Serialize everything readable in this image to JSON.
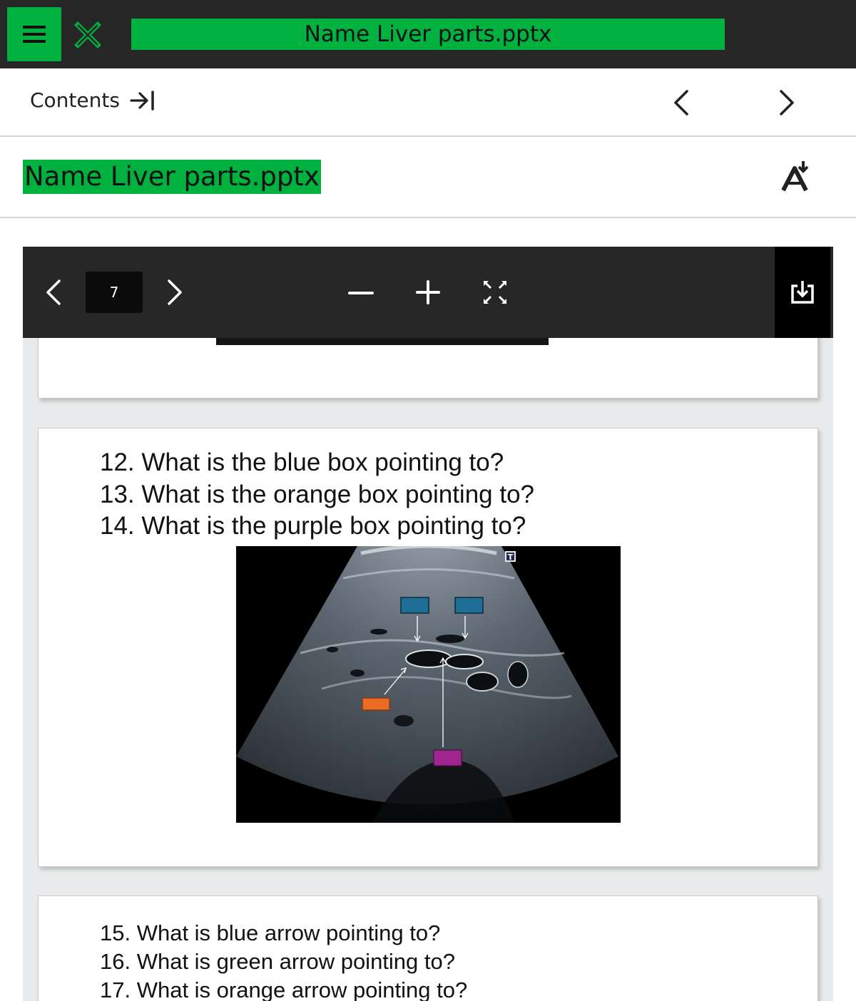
{
  "app": {
    "title": "Name Liver parts.pptx",
    "menu_icon": "hamburger-menu-icon",
    "close_icon": "close-x-icon"
  },
  "contents_bar": {
    "label": "Contents",
    "collapse_icon": "arrow-to-end-icon",
    "prev_icon": "chevron-left-icon",
    "next_icon": "chevron-right-icon"
  },
  "document": {
    "title": "Name Liver parts.pptx",
    "accessibility_icon": "font-accessibility-icon"
  },
  "viewer": {
    "page_number": "7",
    "toolbar_icons": [
      "chevron-left-icon",
      "chevron-right-icon",
      "minus-icon",
      "plus-icon",
      "fit-to-page-icon",
      "download-icon"
    ]
  },
  "slides": {
    "middle": {
      "questions": [
        "12. What is the blue box pointing to?",
        "13. What is the orange box pointing to?",
        "14. What is the purple box pointing to?"
      ],
      "image_marker": "T"
    },
    "bottom": {
      "questions": [
        "15. What is blue arrow pointing to?",
        "16. What is green arrow pointing to?",
        "17. What is orange arrow pointing to?"
      ]
    }
  },
  "colors": {
    "accent_green": "#00b140",
    "topbar_bg": "#262626",
    "toolbar_bg": "#272727",
    "blue_box": "#1f6e96",
    "orange_box": "#ec6b24",
    "purple_box": "#a0268f"
  }
}
